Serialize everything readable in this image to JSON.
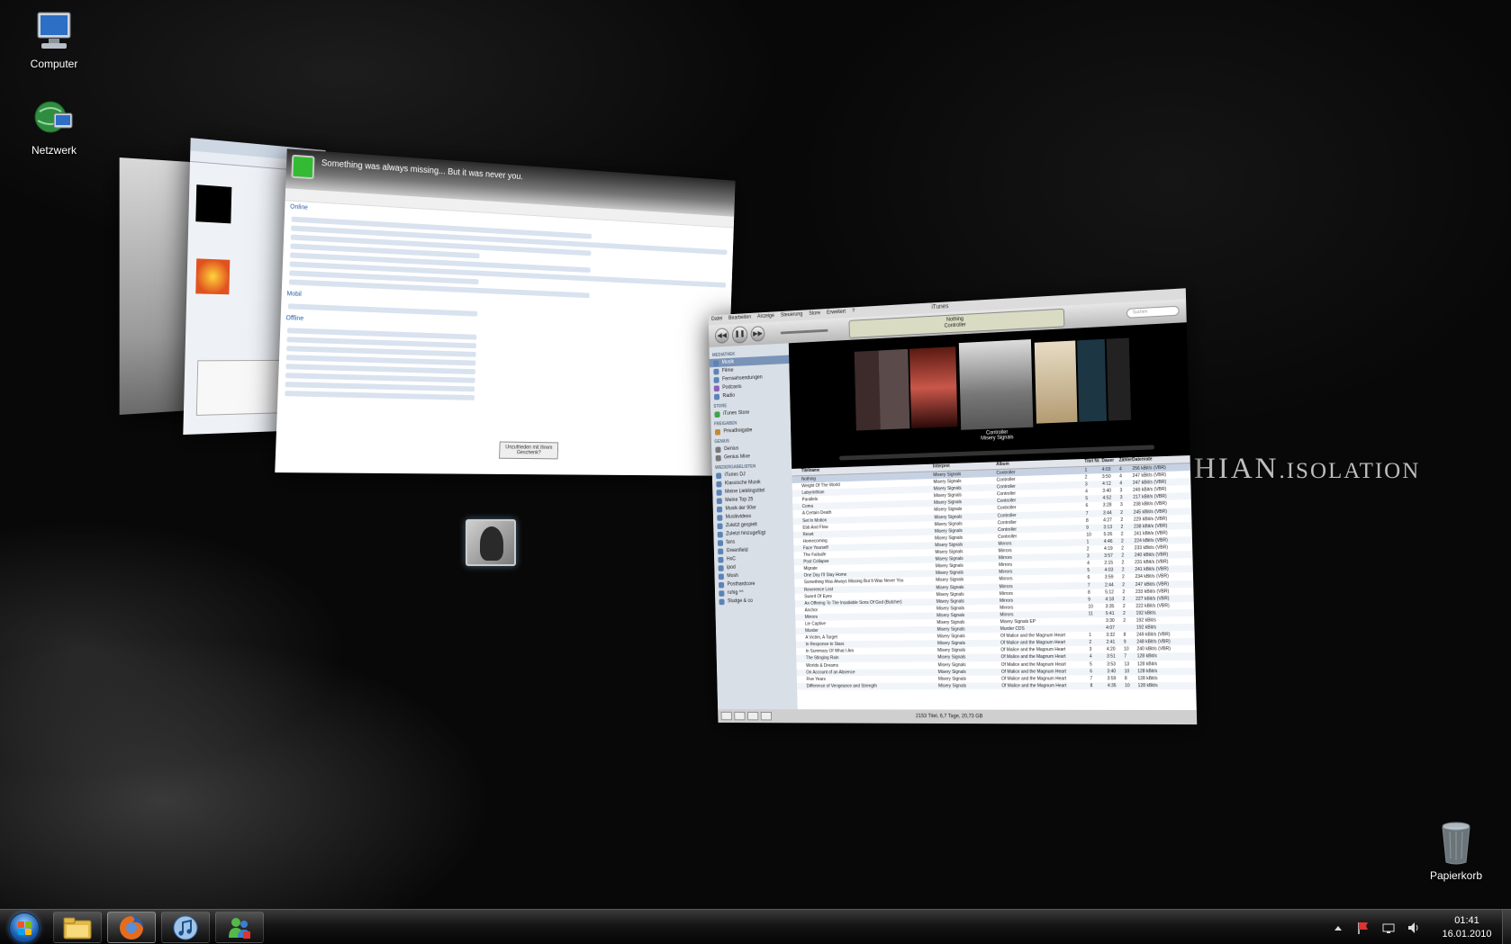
{
  "desktop": {
    "icons": [
      {
        "label": "Computer",
        "icon": "computer-icon"
      },
      {
        "label": "Netzwerk",
        "icon": "network-icon"
      },
      {
        "label": "Papierkorb",
        "icon": "recycle-bin-icon"
      }
    ],
    "wallpaper_text": {
      "main": "HIAN",
      "suffix": ".ISOLATION"
    }
  },
  "msn_window": {
    "status_message": "Something was always missing... But it was never you.",
    "group_online": "Online",
    "group_mobile": "Mobil",
    "group_offline": "Offline",
    "offer_button": "Unzufrieden mit Ihrem Geschenk?"
  },
  "itunes": {
    "title": "iTunes",
    "menu": [
      "Datei",
      "Bearbeiten",
      "Anzeige",
      "Steuerung",
      "Store",
      "Erweitert",
      "?"
    ],
    "now_playing": {
      "track": "Nothing",
      "album": "Controller"
    },
    "search_placeholder": "Suchen",
    "sidebar": {
      "library_header": "MEDIATHEK",
      "library": [
        "Musik",
        "Filme",
        "Fernsehsendungen",
        "Podcasts",
        "Radio"
      ],
      "store_header": "STORE",
      "store": [
        "iTunes Store"
      ],
      "shared_header": "FREIGABEN",
      "shared": [
        "Privatfreigabe"
      ],
      "genius_header": "GENIUS",
      "genius": [
        "Genius",
        "Genius Mixe"
      ],
      "playlists_header": "WIEDERGABELISTEN",
      "playlists": [
        "iTunes DJ",
        "Klassische Musik",
        "Meine Lieblingstitel",
        "Meine Top 25",
        "Musik der 90er",
        "Musikvideos",
        "Zuletzt gespielt",
        "Zuletzt hinzugefügt",
        "fans",
        "Greenfield",
        "HxC",
        "ipod",
        "Mosh",
        "Posthardcore",
        "ruhig ^^",
        "Sludge & co"
      ]
    },
    "coverflow": {
      "album": "Controller",
      "artist": "Misery Signals"
    },
    "columns": [
      "Titelname",
      "Interpret",
      "Album",
      "Titel Nr.",
      "Dauer",
      "Zähler",
      "Datenrate"
    ],
    "tracks": [
      {
        "name": "Nothing",
        "artist": "Misery Signals",
        "album": "Controller",
        "no": "1",
        "time": "4:03",
        "plays": "4",
        "rate": "256 kBit/s (VBR)"
      },
      {
        "name": "Weight Of The World",
        "artist": "Misery Signals",
        "album": "Controller",
        "no": "2",
        "time": "3:50",
        "plays": "4",
        "rate": "247 kBit/s (VBR)"
      },
      {
        "name": "Labyrinthian",
        "artist": "Misery Signals",
        "album": "Controller",
        "no": "3",
        "time": "4:12",
        "plays": "4",
        "rate": "247 kBit/s (VBR)"
      },
      {
        "name": "Parallels",
        "artist": "Misery Signals",
        "album": "Controller",
        "no": "4",
        "time": "3:40",
        "plays": "3",
        "rate": "249 kBit/s (VBR)"
      },
      {
        "name": "Coma",
        "artist": "Misery Signals",
        "album": "Controller",
        "no": "5",
        "time": "4:52",
        "plays": "3",
        "rate": "217 kBit/s (VBR)"
      },
      {
        "name": "A Certain Death",
        "artist": "Misery Signals",
        "album": "Controller",
        "no": "6",
        "time": "3:28",
        "plays": "3",
        "rate": "238 kBit/s (VBR)"
      },
      {
        "name": "Set In Motion",
        "artist": "Misery Signals",
        "album": "Controller",
        "no": "7",
        "time": "3:44",
        "plays": "2",
        "rate": "245 kBit/s (VBR)"
      },
      {
        "name": "Ebb And Flow",
        "artist": "Misery Signals",
        "album": "Controller",
        "no": "8",
        "time": "4:27",
        "plays": "2",
        "rate": "229 kBit/s (VBR)"
      },
      {
        "name": "Reset",
        "artist": "Misery Signals",
        "album": "Controller",
        "no": "9",
        "time": "3:13",
        "plays": "2",
        "rate": "238 kBit/s (VBR)"
      },
      {
        "name": "Homecoming",
        "artist": "Misery Signals",
        "album": "Controller",
        "no": "10",
        "time": "5:26",
        "plays": "2",
        "rate": "241 kBit/s (VBR)"
      },
      {
        "name": "Face Yourself",
        "artist": "Misery Signals",
        "album": "Mirrors",
        "no": "1",
        "time": "4:46",
        "plays": "2",
        "rate": "224 kBit/s (VBR)"
      },
      {
        "name": "The Failsafe",
        "artist": "Misery Signals",
        "album": "Mirrors",
        "no": "2",
        "time": "4:19",
        "plays": "2",
        "rate": "233 kBit/s (VBR)"
      },
      {
        "name": "Post Collapse",
        "artist": "Misery Signals",
        "album": "Mirrors",
        "no": "3",
        "time": "3:57",
        "plays": "2",
        "rate": "240 kBit/s (VBR)"
      },
      {
        "name": "Migrate",
        "artist": "Misery Signals",
        "album": "Mirrors",
        "no": "4",
        "time": "2:15",
        "plays": "2",
        "rate": "231 kBit/s (VBR)"
      },
      {
        "name": "One Day I'll Stay Home",
        "artist": "Misery Signals",
        "album": "Mirrors",
        "no": "5",
        "time": "4:03",
        "plays": "2",
        "rate": "241 kBit/s (VBR)"
      },
      {
        "name": "Something Was Always Missing But It Was Never You",
        "artist": "Misery Signals",
        "album": "Mirrors",
        "no": "6",
        "time": "3:59",
        "plays": "2",
        "rate": "234 kBit/s (VBR)"
      },
      {
        "name": "Reverence Lost",
        "artist": "Misery Signals",
        "album": "Mirrors",
        "no": "7",
        "time": "2:44",
        "plays": "2",
        "rate": "247 kBit/s (VBR)"
      },
      {
        "name": "Sword Of Eyes",
        "artist": "Misery Signals",
        "album": "Mirrors",
        "no": "8",
        "time": "5:12",
        "plays": "2",
        "rate": "233 kBit/s (VBR)"
      },
      {
        "name": "An Offering To The Insatiable Sons Of God (Butcher)",
        "artist": "Misery Signals",
        "album": "Mirrors",
        "no": "9",
        "time": "4:18",
        "plays": "2",
        "rate": "227 kBit/s (VBR)"
      },
      {
        "name": "Anchor",
        "artist": "Misery Signals",
        "album": "Mirrors",
        "no": "10",
        "time": "3:35",
        "plays": "2",
        "rate": "222 kBit/s (VBR)"
      },
      {
        "name": "Mirrors",
        "artist": "Misery Signals",
        "album": "Mirrors",
        "no": "11",
        "time": "5:41",
        "plays": "2",
        "rate": "192 kBit/s"
      },
      {
        "name": "Lie Captive",
        "artist": "Misery Signals",
        "album": "Misery Signals EP",
        "no": "",
        "time": "3:30",
        "plays": "2",
        "rate": "192 kBit/s"
      },
      {
        "name": "Murder",
        "artist": "Misery Signals",
        "album": "Murder CDS",
        "no": "",
        "time": "4:07",
        "plays": "",
        "rate": "192 kBit/s"
      },
      {
        "name": "A Victim, A Target",
        "artist": "Misery Signals",
        "album": "Of Malice and the Magnum Heart",
        "no": "1",
        "time": "3:32",
        "plays": "8",
        "rate": "249 kBit/s (VBR)"
      },
      {
        "name": "In Response to Stars",
        "artist": "Misery Signals",
        "album": "Of Malice and the Magnum Heart",
        "no": "2",
        "time": "2:41",
        "plays": "9",
        "rate": "248 kBit/s (VBR)"
      },
      {
        "name": "In Summary Of What I Am",
        "artist": "Misery Signals",
        "album": "Of Malice and the Magnum Heart",
        "no": "3",
        "time": "4:20",
        "plays": "10",
        "rate": "240 kBit/s (VBR)"
      },
      {
        "name": "The Stinging Rain",
        "artist": "Misery Signals",
        "album": "Of Malice and the Magnum Heart",
        "no": "4",
        "time": "3:51",
        "plays": "7",
        "rate": "128 kBit/s"
      },
      {
        "name": "Worlds & Dreams",
        "artist": "Misery Signals",
        "album": "Of Malice and the Magnum Heart",
        "no": "5",
        "time": "3:53",
        "plays": "13",
        "rate": "128 kBit/s"
      },
      {
        "name": "On Account of an Absence",
        "artist": "Misery Signals",
        "album": "Of Malice and the Magnum Heart",
        "no": "6",
        "time": "3:40",
        "plays": "10",
        "rate": "128 kBit/s"
      },
      {
        "name": "Five Years",
        "artist": "Misery Signals",
        "album": "Of Malice and the Magnum Heart",
        "no": "7",
        "time": "3:59",
        "plays": "8",
        "rate": "128 kBit/s"
      },
      {
        "name": "Difference of Vengeance and Strength",
        "artist": "Misery Signals",
        "album": "Of Malice and the Magnum Heart",
        "no": "8",
        "time": "4:35",
        "plays": "10",
        "rate": "128 kBit/s"
      }
    ],
    "status_text": "2153 Titel, 6,7 Tage, 20,73 GB"
  },
  "taskbar": {
    "pinned": [
      {
        "name": "explorer-icon"
      },
      {
        "name": "firefox-icon"
      },
      {
        "name": "itunes-icon"
      },
      {
        "name": "messenger-icon"
      }
    ],
    "clock_time": "01:41",
    "clock_date": "16.01.2010"
  }
}
